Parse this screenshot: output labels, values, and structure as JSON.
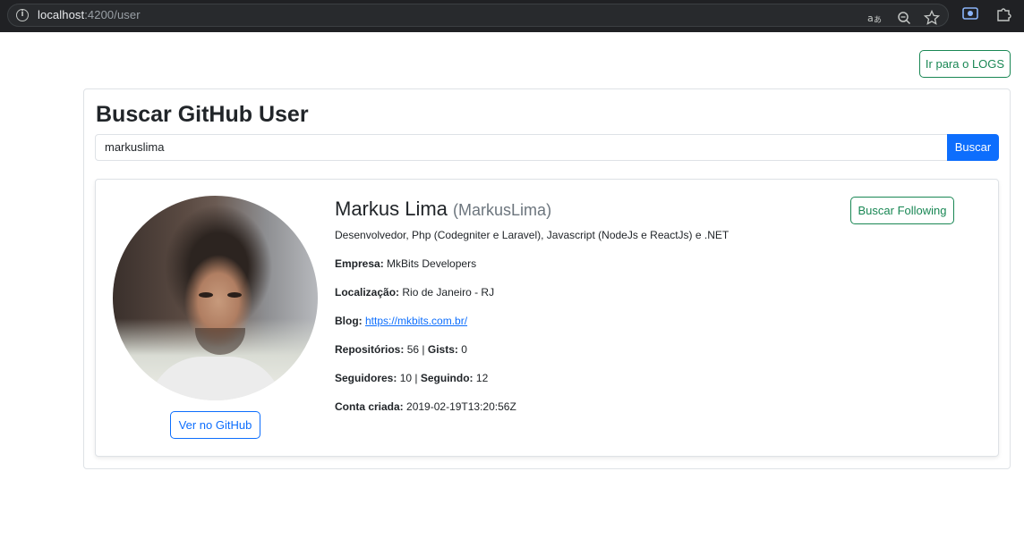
{
  "browser": {
    "url_host": "localhost",
    "url_path": ":4200/user",
    "icons": [
      "info-icon",
      "translate-icon",
      "zoom-icon",
      "bookmark-star-icon",
      "screenshot-icon",
      "extensions-icon"
    ]
  },
  "header": {
    "logs_button_label": "Ir para o LOGS"
  },
  "search": {
    "title": "Buscar GitHub User",
    "input_value": "markuslima",
    "button_label": "Buscar"
  },
  "profile": {
    "name": "Markus Lima",
    "login": "(MarkusLima)",
    "bio": "Desenvolvedor, Php (Codegniter e Laravel), Javascript (NodeJs e ReactJs) e .NET",
    "following_button_label": "Buscar Following",
    "github_button_label": "Ver no GitHub",
    "company_label": "Empresa:",
    "company": "MkBits Developers",
    "location_label": "Localização:",
    "location": "Rio de Janeiro - RJ",
    "blog_label": "Blog:",
    "blog": "https://mkbits.com.br/",
    "repos_label": "Repositórios:",
    "repos": "56",
    "separator": "|",
    "gists_label": "Gists:",
    "gists": "0",
    "followers_label": "Seguidores:",
    "followers": "10",
    "following_label": "Seguindo:",
    "following": "12",
    "created_label": "Conta criada:",
    "created": "2019-02-19T13:20:56Z"
  },
  "colors": {
    "primary": "#0d6efd",
    "success": "#198754",
    "chrome_bar": "#202124"
  }
}
